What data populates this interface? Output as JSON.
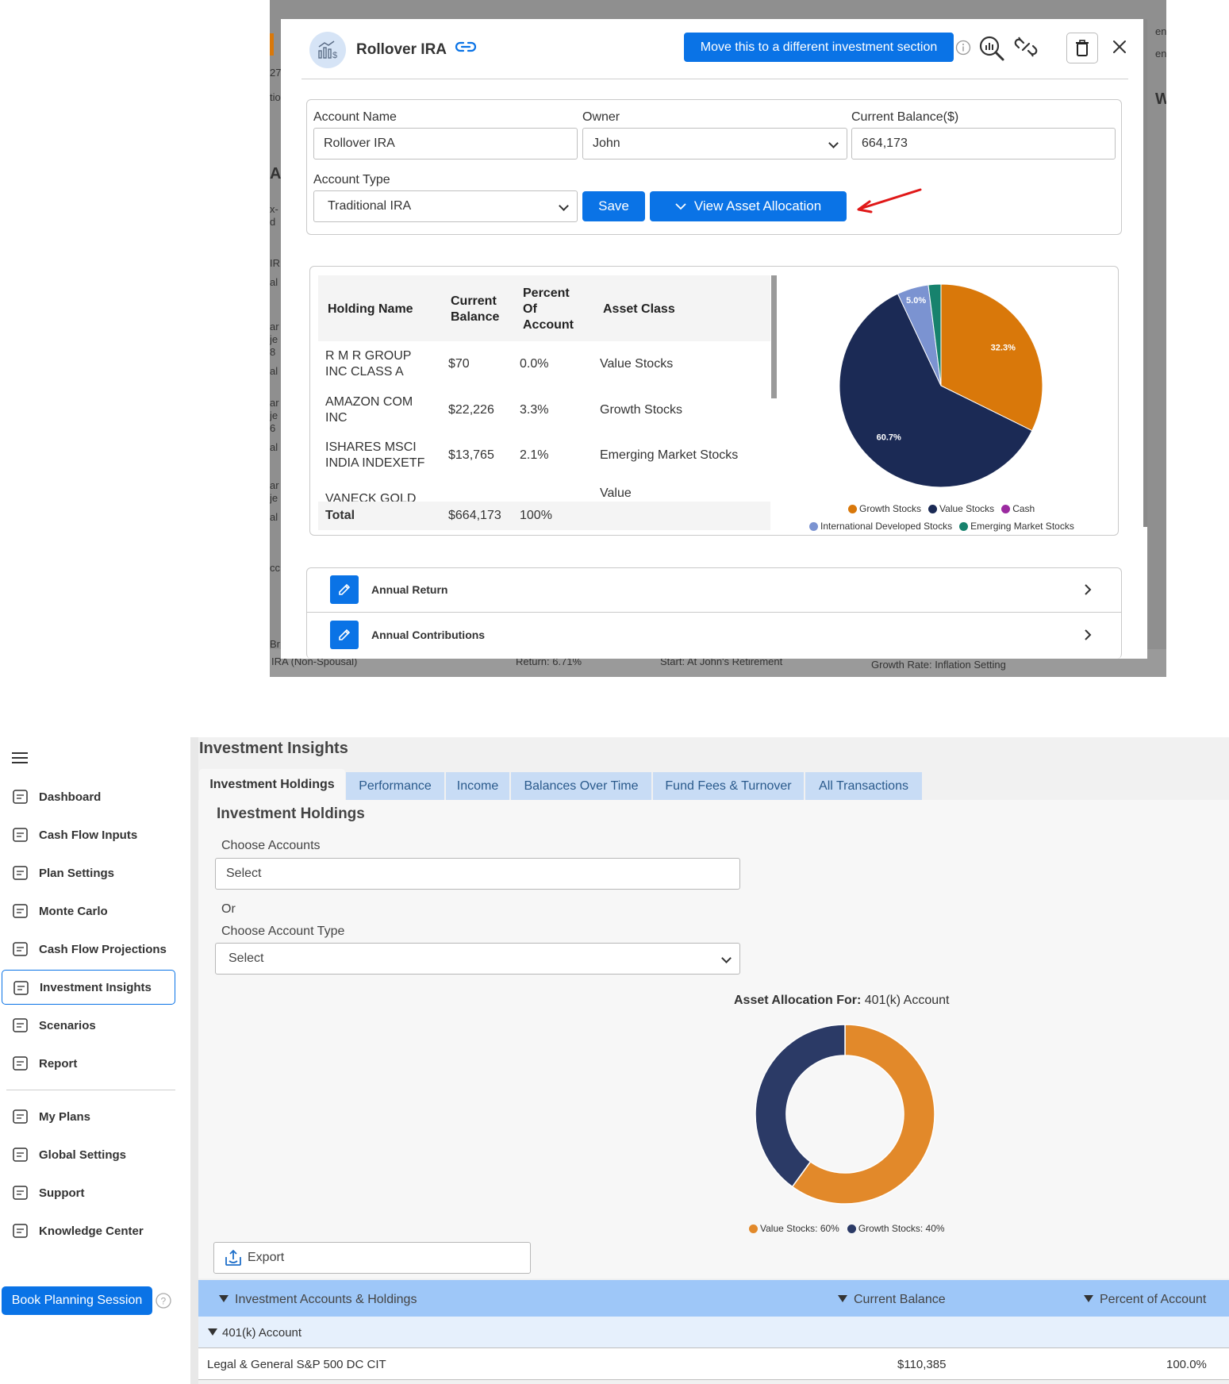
{
  "background_fragments": {
    "left_column": [
      "27",
      "tio",
      "Ac",
      "x-",
      "d",
      "IR",
      "al",
      "ar",
      "je",
      "8",
      "al",
      "ar",
      "je",
      "6",
      "al",
      "ar",
      "je",
      "al",
      "cc",
      "Br",
      "IRA (Non-Spousal)"
    ],
    "right_column": [
      "en",
      "en",
      "W"
    ],
    "footer": [
      "Return: 6.71%",
      "Start: At John's Retirement",
      "Growth Rate: Inflation Setting"
    ]
  },
  "modal": {
    "title": "Rollover IRA",
    "move_button_label": "Move this to a different investment section",
    "icons": {
      "account": "investment-chart-icon",
      "link": "link-icon",
      "info": "info-icon",
      "search": "magnify-chart-icon",
      "unlink": "unlink-icon",
      "delete": "trash-icon",
      "close": "close-icon"
    },
    "form": {
      "account_name_label": "Account Name",
      "account_name_value": "Rollover IRA",
      "owner_label": "Owner",
      "owner_value": "John",
      "balance_label": "Current Balance($)",
      "balance_value": "664,173",
      "account_type_label": "Account Type",
      "account_type_value": "Traditional IRA",
      "save_label": "Save",
      "view_allocation_label": "View Asset Allocation"
    },
    "holdings_table": {
      "headers": {
        "name": "Holding Name",
        "balance_1": "Current",
        "balance_2": "Balance",
        "percent_1": "Percent",
        "percent_2": "Of",
        "percent_3": "Account",
        "asset_class": "Asset Class"
      },
      "rows": [
        {
          "name_1": "R M R GROUP",
          "name_2": "INC CLASS A",
          "balance": "$70",
          "percent": "0.0%",
          "asset_class": "Value Stocks"
        },
        {
          "name_1": "AMAZON COM",
          "name_2": "INC",
          "balance": "$22,226",
          "percent": "3.3%",
          "asset_class": "Growth Stocks"
        },
        {
          "name_1": "ISHARES MSCI",
          "name_2": "INDIA INDEXETF",
          "balance": "$13,765",
          "percent": "2.1%",
          "asset_class": "Emerging Market Stocks"
        },
        {
          "name_1": "VANECK GOLD",
          "asset_class": "Value"
        }
      ],
      "total": {
        "label": "Total",
        "balance": "$664,173",
        "percent": "100%"
      }
    },
    "accordion": [
      {
        "label": "Annual Return"
      },
      {
        "label": "Annual Contributions"
      }
    ]
  },
  "chart_data": [
    {
      "type": "pie",
      "series": [
        {
          "name": "Growth Stocks",
          "value": 32.3,
          "color": "#d9780a",
          "label": "32.3%"
        },
        {
          "name": "Value Stocks",
          "value": 60.7,
          "color": "#1b2a55",
          "label": "60.7%"
        },
        {
          "name": "International Developed Stocks",
          "value": 5.0,
          "color": "#7b93d1",
          "label": "5.0%"
        },
        {
          "name": "Emerging Market Stocks",
          "value": 2.0,
          "color": "#17826d",
          "label": ""
        },
        {
          "name": "Cash",
          "value": 0.0,
          "color": "#9b2aa0",
          "label": ""
        }
      ],
      "legend_order": [
        "Growth Stocks",
        "Value Stocks",
        "Cash",
        "International Developed Stocks",
        "Emerging Market Stocks"
      ],
      "legend_position": "bottom"
    },
    {
      "type": "pie",
      "variant": "donut",
      "title_bold": "Asset Allocation For:",
      "title_rest": "401(k) Account",
      "series": [
        {
          "name": "Value Stocks",
          "value": 60,
          "color": "#e2892a",
          "legend": "Value Stocks: 60%"
        },
        {
          "name": "Growth Stocks",
          "value": 40,
          "color": "#2b3a66",
          "legend": "Growth Stocks: 40%"
        }
      ],
      "legend_position": "bottom"
    }
  ],
  "app": {
    "sidebar": {
      "items": [
        {
          "label": "Dashboard",
          "icon": "dashboard-icon"
        },
        {
          "label": "Cash Flow Inputs",
          "icon": "cash-flow-inputs-icon"
        },
        {
          "label": "Plan Settings",
          "icon": "gear-icon"
        },
        {
          "label": "Monte Carlo",
          "icon": "bar-chart-icon"
        },
        {
          "label": "Cash Flow Projections",
          "icon": "wallet-icon"
        },
        {
          "label": "Investment Insights",
          "icon": "document-search-icon",
          "active": true
        },
        {
          "label": "Scenarios",
          "icon": "abacus-icon"
        },
        {
          "label": "Report",
          "icon": "report-icon"
        }
      ],
      "secondary_items": [
        {
          "label": "My Plans",
          "icon": "clipboard-icon"
        },
        {
          "label": "Global Settings",
          "icon": "globe-icon"
        },
        {
          "label": "Support",
          "icon": "chat-help-icon"
        },
        {
          "label": "Knowledge Center",
          "icon": "lightbulb-icon"
        }
      ],
      "book_button_label": "Book Planning Session"
    },
    "page_title": "Investment Insights",
    "tabs": [
      "Investment Holdings",
      "Performance",
      "Income",
      "Balances Over Time",
      "Fund Fees & Turnover",
      "All Transactions"
    ],
    "section_title": "Investment Holdings",
    "choose_accounts_label": "Choose Accounts",
    "choose_accounts_value": "Select",
    "or_label": "Or",
    "choose_type_label": "Choose Account Type",
    "choose_type_value": "Select",
    "export_label": "Export",
    "grid": {
      "headers": [
        "Investment Accounts & Holdings",
        "Current Balance",
        "Percent of Account"
      ],
      "group_label": "401(k) Account",
      "rows": [
        {
          "name": "Legal & General S&P 500 DC CIT",
          "balance": "$110,385",
          "percent": "100.0%"
        }
      ]
    }
  }
}
